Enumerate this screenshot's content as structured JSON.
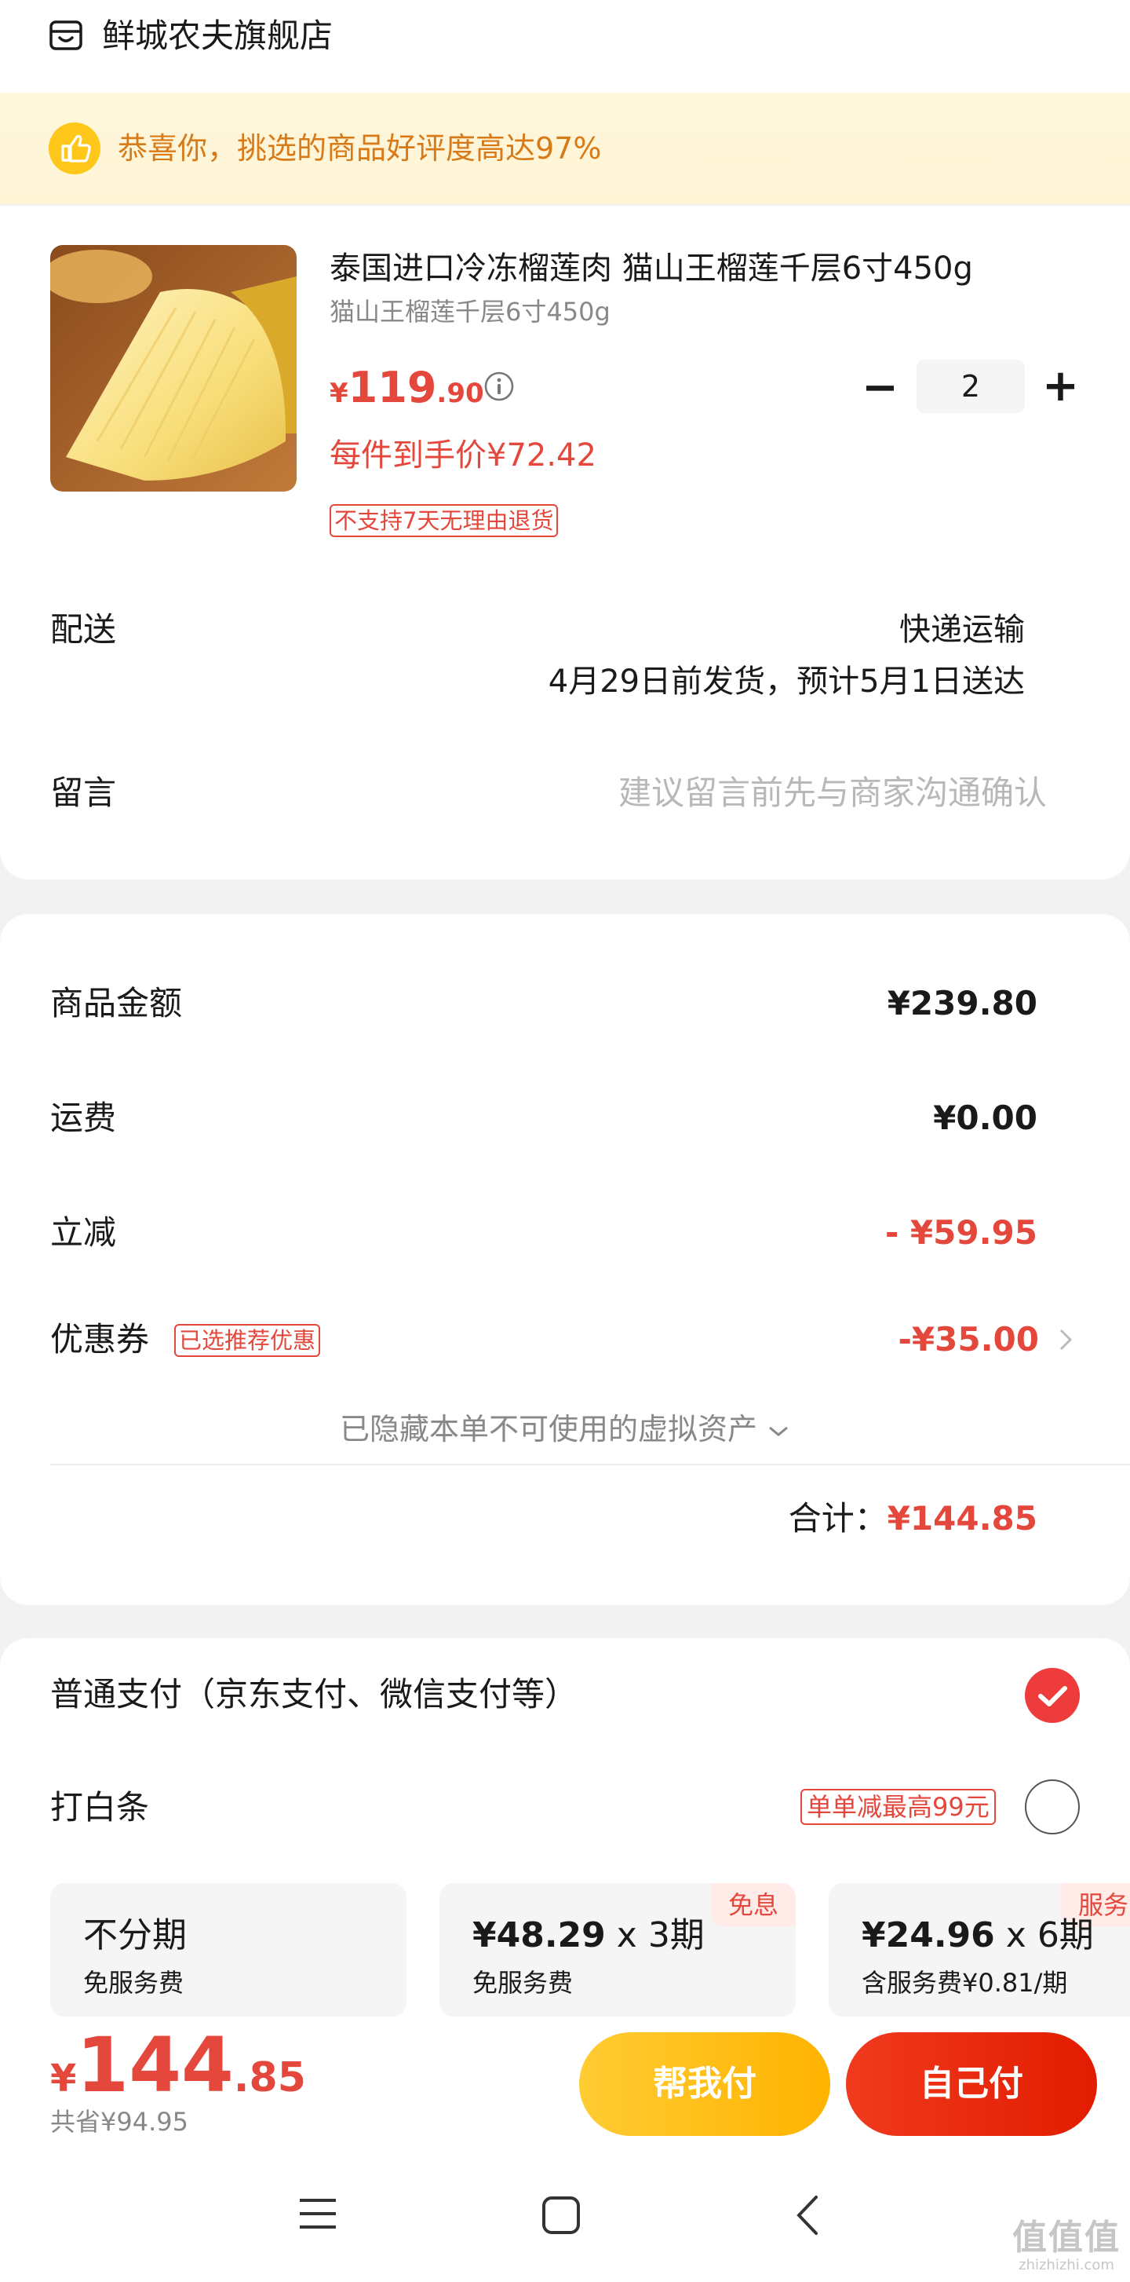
{
  "store": {
    "name": "鲜城农夫旗舰店",
    "icon": "store-icon"
  },
  "banner": {
    "text": "恭喜你，挑选的商品好评度高达97%",
    "icon": "thumbs-up-icon"
  },
  "product": {
    "title": "泰国进口冷冻榴莲肉 猫山王榴莲千层6寸450g",
    "spec": "猫山王榴莲千层6寸450g",
    "price_symbol": "¥",
    "price_int": "119",
    "price_dec": ".90",
    "net_price": "每件到手价¥72.42",
    "return_tag": "不支持7天无理由退货",
    "quantity": "2",
    "minus": "−",
    "plus": "+"
  },
  "delivery": {
    "label": "配送",
    "method": "快递运输",
    "schedule": "4月29日前发货，预计5月1日送达"
  },
  "message": {
    "label": "留言",
    "placeholder": "建议留言前先与商家沟通确认"
  },
  "summary": {
    "goods_label": "商品金额",
    "goods_value": "¥239.80",
    "shipping_label": "运费",
    "shipping_value": "¥0.00",
    "discount_label": "立减",
    "discount_value": "- ¥59.95",
    "coupon_label": "优惠券",
    "coupon_tag": "已选推荐优惠",
    "coupon_value": "-¥35.00",
    "hidden_assets": "已隐藏本单不可使用的虚拟资产",
    "total_label": "合计：",
    "total_value": "¥144.85"
  },
  "payment": {
    "normal_label": "普通支付（京东支付、微信支付等）",
    "normal_selected": true,
    "baitiao_label": "打白条",
    "baitiao_tag": "单单减最高99元",
    "plans": [
      {
        "title": "不分期",
        "sub": "免服务费",
        "badge": ""
      },
      {
        "title_amount": "¥48.29",
        "title_x": " x ",
        "title_term": "3期",
        "sub": "免服务费",
        "badge": "免息"
      },
      {
        "title_amount": "¥24.96",
        "title_x": " x ",
        "title_term": "6期",
        "sub": "含服务费¥0.81/期",
        "badge": "服务"
      }
    ]
  },
  "footer": {
    "price_symbol": "¥",
    "price_int": "144",
    "price_dec": ".85",
    "saved": "共省¥94.95",
    "help_pay": "帮我付",
    "self_pay": "自己付"
  },
  "nav": {
    "menu_icon": "menu-icon",
    "home_icon": "home-icon",
    "back_icon": "back-icon"
  },
  "watermark": {
    "logo": "值值值",
    "domain": "zhizhizhi.com"
  },
  "colors": {
    "accent_red": "#e4473b",
    "pay_red": "#e8260f",
    "pay_yellow": "#ffb800",
    "banner_text": "#d77a17"
  }
}
